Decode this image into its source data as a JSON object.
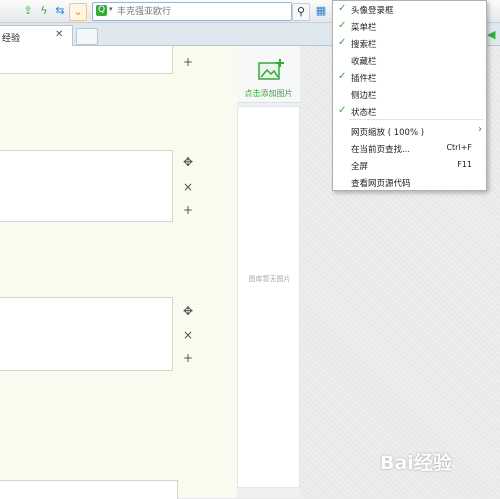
{
  "toolbar": {
    "search_placeholder": "丰克强亚欧行"
  },
  "tabs": [
    {
      "title": "经验"
    }
  ],
  "image_panel": {
    "add_label": "点击添加图片",
    "empty_text": "图库暂无图片"
  },
  "menu": {
    "items": [
      {
        "label": "头像登录框",
        "checked": true
      },
      {
        "label": "菜单栏",
        "checked": true
      },
      {
        "label": "搜索栏",
        "checked": true
      },
      {
        "label": "收藏栏",
        "checked": false
      },
      {
        "label": "插件栏",
        "checked": true
      },
      {
        "label": "侧边栏",
        "checked": false
      },
      {
        "label": "状态栏",
        "checked": true
      }
    ],
    "zoom": {
      "label": "网页缩放 ( 100% )"
    },
    "find": {
      "label": "在当前页查找...",
      "shortcut": "Ctrl+F"
    },
    "fullscreen": {
      "label": "全屏",
      "shortcut": "F11"
    },
    "view_source": {
      "label": "查看网页源代码"
    }
  },
  "watermark": {
    "text": "Bai经验"
  },
  "colors": {
    "accent": "#3aa73a",
    "panel": "#fbfaee",
    "menu_border": "#b0b0b0"
  }
}
